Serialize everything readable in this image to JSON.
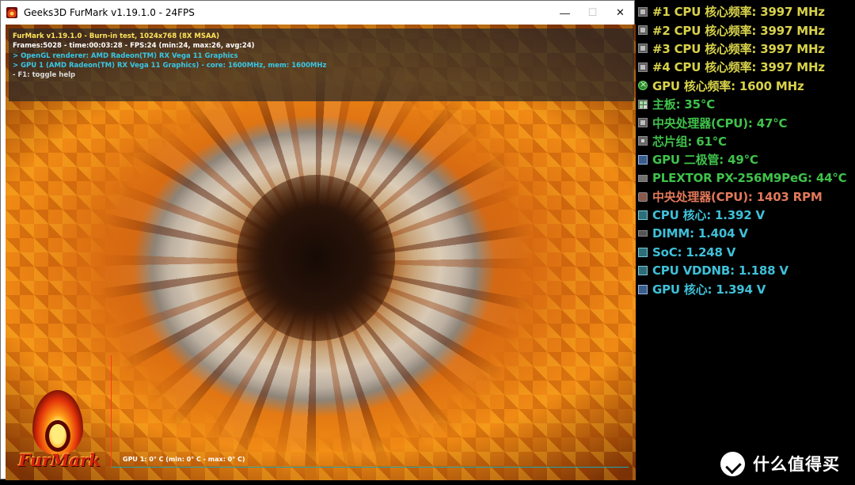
{
  "window": {
    "title": "Geeks3D FurMark v1.19.1.0 - 24FPS",
    "controls": {
      "minimize": "—",
      "maximize": "☐",
      "close": "✕"
    }
  },
  "osd": {
    "lines": [
      "FurMark v1.19.1.0 - Burn-in test, 1024x768 (8X MSAA)",
      "Frames:5028 - time:00:03:28 - FPS:24 (min:24, max:26, avg:24)",
      "> OpenGL renderer: AMD Radeon(TM) RX Vega 11 Graphics",
      "> GPU 1 (AMD Radeon(TM) RX Vega 11 Graphics) - core: 1600MHz, mem: 1600MHz",
      "- F1: toggle help"
    ]
  },
  "temp_graph": {
    "label": "GPU 1: 0° C (min: 0° C - max: 0° C)"
  },
  "logo": {
    "text": "FurMark"
  },
  "sensors": [
    {
      "icon": "cpu",
      "text": "#1 CPU 核心频率: 3997 MHz",
      "color": "#d8d24a"
    },
    {
      "icon": "cpu",
      "text": "#2 CPU 核心频率: 3997 MHz",
      "color": "#d8d24a"
    },
    {
      "icon": "cpu",
      "text": "#3 CPU 核心频率: 3997 MHz",
      "color": "#d8d24a"
    },
    {
      "icon": "cpu",
      "text": "#4 CPU 核心频率: 3997 MHz",
      "color": "#d8d24a"
    },
    {
      "icon": "gpu",
      "text": "GPU 核心频率: 1600 MHz",
      "color": "#d8d24a"
    },
    {
      "icon": "board",
      "text": "主板: 35°C",
      "color": "#3fc24a"
    },
    {
      "icon": "cpu",
      "text": "中央处理器(CPU): 47°C",
      "color": "#3fc24a"
    },
    {
      "icon": "chip",
      "text": "芯片组: 61°C",
      "color": "#3fc24a"
    },
    {
      "icon": "monitor",
      "text": "GPU 二极管: 49°C",
      "color": "#3fc24a"
    },
    {
      "icon": "drive",
      "text": "PLEXTOR PX-256M9PeG: 44°C",
      "color": "#3fc24a"
    },
    {
      "icon": "fan",
      "text": "中央处理器(CPU): 1403 RPM",
      "color": "#e2785a"
    },
    {
      "icon": "volt",
      "text": "CPU 核心: 1.392 V",
      "color": "#3ec0d8"
    },
    {
      "icon": "mem",
      "text": "DIMM: 1.404 V",
      "color": "#3ec0d8"
    },
    {
      "icon": "volt",
      "text": "SoC: 1.248 V",
      "color": "#3ec0d8"
    },
    {
      "icon": "volt",
      "text": "CPU VDDNB: 1.188 V",
      "color": "#3ec0d8"
    },
    {
      "icon": "monitor",
      "text": "GPU 核心: 1.394 V",
      "color": "#3ec0d8"
    }
  ],
  "watermark": {
    "text": "什么值得买"
  }
}
